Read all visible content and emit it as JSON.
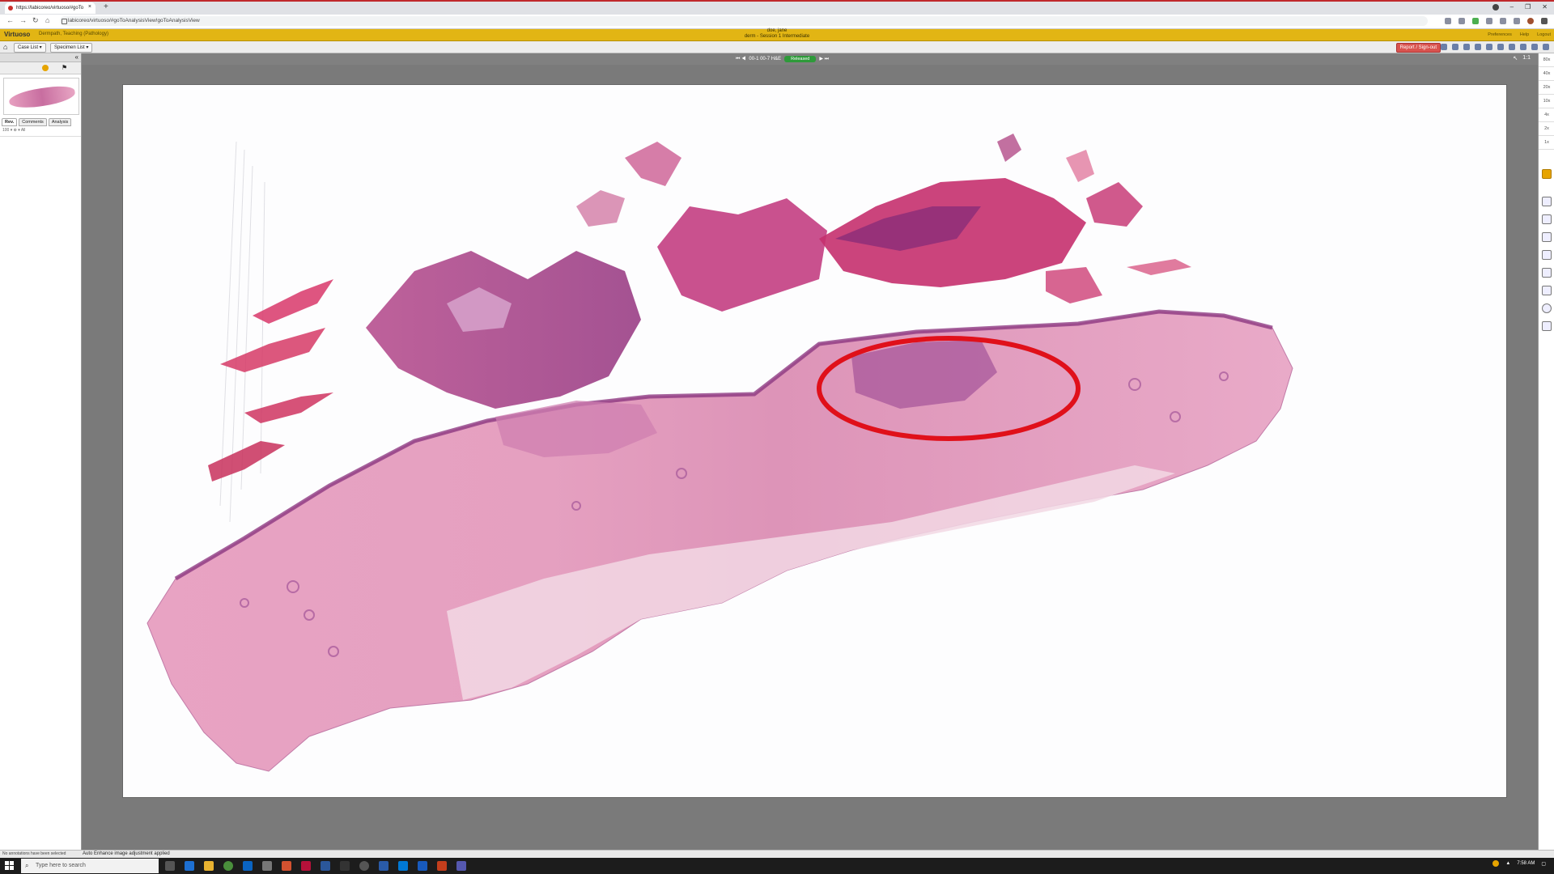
{
  "browser": {
    "tab_title": "https://labicoreo/virtuoso/#goTo",
    "tab_close": "×",
    "new_tab": "+",
    "url": "labicoreo/virtuoso/#goToAnalysisView!goToAnalysisView",
    "window_controls": [
      "–",
      "❐",
      "✕"
    ]
  },
  "app": {
    "logo": "Virtuoso",
    "context": "Dermpath, Teaching (Pathology)",
    "user_name": "doe, jane",
    "session": "derm - Session 1 Intermediate",
    "links": [
      "Preferences",
      "Help",
      "Logout"
    ]
  },
  "menu": {
    "case_list": "Case List ▾",
    "specimen_list": "Specimen List ▾",
    "report_signout": "Report / Sign-out"
  },
  "left_panel": {
    "tabs": [
      "Rev.",
      "Comments",
      "Analysis"
    ],
    "row1": "100 ▾ ⊕ ▾ All"
  },
  "viewer": {
    "slide_label": "00-1 00-7 H&E",
    "status_badge": "Released",
    "prev": "⏮ ◀",
    "next": "▶ ⏭"
  },
  "zoom_levels": [
    "80x",
    "40x",
    "20x",
    "10x",
    "4x",
    "2x",
    "1x"
  ],
  "status": {
    "left": "No annotations have been selected",
    "main": "Auto Enhance image adjustment applied"
  },
  "taskbar": {
    "search_placeholder": "Type here to search",
    "time": "7:58 AM",
    "date": ""
  },
  "colors": {
    "app_header": "#e2b514",
    "annotation": "#e0101a",
    "released": "#2e9a3a",
    "report_button": "#d9534f"
  }
}
